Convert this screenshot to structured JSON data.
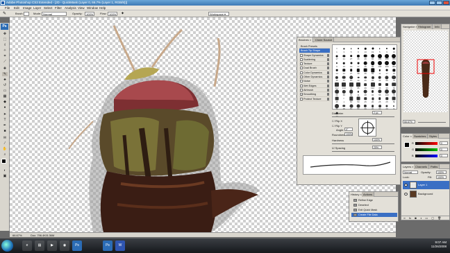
{
  "window": {
    "title": "Adobe Photoshop CS3 Extended - [JD - QuickMask (Layer 0, 66.7% (Layer 1, RGB/8))]"
  },
  "menu": [
    "File",
    "Edit",
    "Image",
    "Layer",
    "Select",
    "Filter",
    "Analysis",
    "View",
    "Window",
    "Help"
  ],
  "options_bar": {
    "brush_label": "Brush:",
    "mode_label": "Mode:",
    "mode_value": "Normal",
    "opacity_label": "Opacity:",
    "opacity_value": "100%",
    "flow_label": "Flow:",
    "flow_value": "100%",
    "workspace_label": "Workspace ▾"
  },
  "status": {
    "zoom": "66.67%",
    "doc": "Doc: 796.4K/5.36M"
  },
  "brushes_panel": {
    "tabs": [
      "Brushes ×",
      "Clone Source"
    ],
    "items": [
      {
        "label": "Brush Presets",
        "checkable": false,
        "checked": false,
        "locked": false,
        "selected": false
      },
      {
        "label": "Brush Tip Shape",
        "checkable": false,
        "checked": false,
        "locked": false,
        "selected": true
      },
      {
        "label": "Shape Dynamics",
        "checkable": true,
        "checked": false,
        "locked": true,
        "selected": false
      },
      {
        "label": "Scattering",
        "checkable": true,
        "checked": false,
        "locked": true,
        "selected": false
      },
      {
        "label": "Texture",
        "checkable": true,
        "checked": false,
        "locked": true,
        "selected": false
      },
      {
        "label": "Dual Brush",
        "checkable": true,
        "checked": false,
        "locked": true,
        "selected": false
      },
      {
        "label": "Color Dynamics",
        "checkable": true,
        "checked": false,
        "locked": true,
        "selected": false
      },
      {
        "label": "Other Dynamics",
        "checkable": true,
        "checked": false,
        "locked": true,
        "selected": false
      },
      {
        "label": "Noise",
        "checkable": true,
        "checked": false,
        "locked": true,
        "selected": false
      },
      {
        "label": "Wet Edges",
        "checkable": true,
        "checked": false,
        "locked": true,
        "selected": false
      },
      {
        "label": "Airbrush",
        "checkable": true,
        "checked": false,
        "locked": true,
        "selected": false
      },
      {
        "label": "Smoothing",
        "checkable": true,
        "checked": true,
        "locked": true,
        "selected": false
      },
      {
        "label": "Protect Texture",
        "checkable": true,
        "checked": false,
        "locked": true,
        "selected": false
      }
    ],
    "preset_sizes": [
      "1",
      "3",
      "5",
      "9",
      "13",
      "19",
      "5",
      "9",
      "13",
      "17",
      "21",
      "27",
      "35",
      "45",
      "65",
      "100",
      "200",
      "300",
      "9",
      "13",
      "19",
      "17",
      "45",
      "65",
      "100",
      "200",
      "300",
      "14",
      "24",
      "27",
      "39",
      "46",
      "59",
      "11",
      "17",
      "23",
      "36",
      "44",
      "60",
      "14",
      "26",
      "33",
      "42",
      "55",
      "70",
      "112",
      "134",
      "74",
      "95",
      "29",
      "192",
      "36",
      "33",
      "63",
      "66",
      "39",
      "63",
      "11",
      "48",
      "32",
      "55",
      "100",
      "75",
      "45",
      "1",
      "60",
      "50",
      "25",
      "20",
      "25",
      "25",
      "50",
      "71",
      "25",
      "50",
      "50",
      "36",
      "30",
      "30",
      "20",
      "9",
      "14"
    ],
    "diameter_label": "Diameter",
    "diameter_value": "2 px",
    "flip_x_label": "Flip X",
    "flip_y_label": "Flip Y",
    "angle_label": "Angle:",
    "angle_value": "0°",
    "roundness_label": "Roundness:",
    "roundness_value": "100%",
    "hardness_label": "Hardness",
    "hardness_value": "100%",
    "spacing_label": "Spacing",
    "spacing_value": "25%"
  },
  "navigator": {
    "tabs": [
      "Navigator ×",
      "Histogram",
      "Info"
    ],
    "zoom_value": "66.67%"
  },
  "color_panel": {
    "tabs": [
      "Color ×",
      "Swatches",
      "Styles"
    ],
    "channels": [
      {
        "label": "R",
        "value": "0",
        "color": "#ff0000"
      },
      {
        "label": "G",
        "value": "0",
        "color": "#00c000"
      },
      {
        "label": "B",
        "value": "0",
        "color": "#0000ff"
      }
    ]
  },
  "layers_panel": {
    "tabs": [
      "Layers ×",
      "Channels",
      "Paths"
    ],
    "blend_mode": "Normal",
    "opacity_label": "Opacity:",
    "opacity_value": "100%",
    "lock_label": "Lock:",
    "fill_label": "Fill:",
    "fill_value": "100%",
    "layers": [
      {
        "name": "Layer 1",
        "selected": true
      },
      {
        "name": "Background",
        "selected": false
      }
    ]
  },
  "history_panel": {
    "tabs": [
      "History ×",
      "Actions"
    ],
    "items": [
      {
        "label": "Refine Edge",
        "selected": false
      },
      {
        "label": "Deselect",
        "selected": false
      },
      {
        "label": "Exit Quick Mask",
        "selected": false
      },
      {
        "label": "Create File Data",
        "selected": true
      }
    ]
  },
  "taskbar": {
    "buttons": [
      "e",
      "▤",
      "▶",
      "◉",
      "Ps",
      "Ps",
      "W"
    ],
    "time": "9:07 AM",
    "date": "11/26/2008"
  },
  "colors": {
    "accent": "#3a6fc4",
    "panel": "#e3e0d8"
  }
}
